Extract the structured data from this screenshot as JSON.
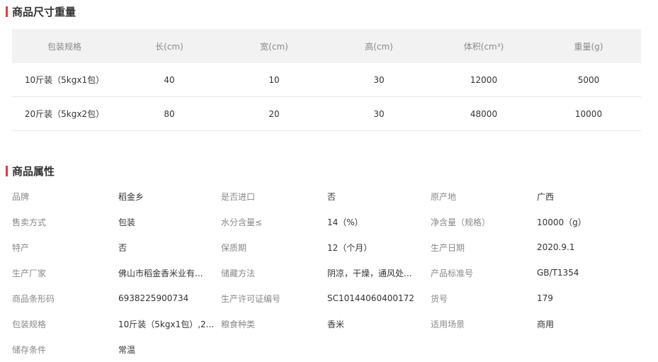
{
  "size_section": {
    "title": "商品尺寸重量",
    "headers": [
      "包装规格",
      "长(cm)",
      "宽(cm)",
      "高(cm)",
      "体积(cm³)",
      "重量(g)"
    ],
    "rows": [
      [
        "10斤装（5kgx1包）",
        "40",
        "10",
        "30",
        "12000",
        "5000"
      ],
      [
        "20斤装（5kgx2包）",
        "80",
        "20",
        "30",
        "48000",
        "10000"
      ]
    ]
  },
  "attr_section": {
    "title": "商品属性",
    "items": [
      {
        "key": "品牌",
        "value": "稻金乡"
      },
      {
        "key": "是否进口",
        "value": "否"
      },
      {
        "key": "原产地",
        "value": "广西"
      },
      {
        "key": "售卖方式",
        "value": "包装"
      },
      {
        "key": "水分含量≤",
        "value": "14（%）"
      },
      {
        "key": "净含量（规格）",
        "value": "10000（g）"
      },
      {
        "key": "特产",
        "value": "否"
      },
      {
        "key": "保质期",
        "value": "12（个月）"
      },
      {
        "key": "生产日期",
        "value": "2020.9.1"
      },
      {
        "key": "生产厂家",
        "value": "佛山市稻金香米业有..."
      },
      {
        "key": "储藏方法",
        "value": "阴凉，干燥，通风处..."
      },
      {
        "key": "产品标准号",
        "value": "GB/T1354"
      },
      {
        "key": "商品条形码",
        "value": "6938225900734"
      },
      {
        "key": "生产许可证编号",
        "value": "SC10144060400172"
      },
      {
        "key": "货号",
        "value": "179"
      },
      {
        "key": "包装规格",
        "value": "10斤装（5kgx1包）,2..."
      },
      {
        "key": "粮食种类",
        "value": "香米"
      },
      {
        "key": "适用场景",
        "value": "商用"
      },
      {
        "key": "储存条件",
        "value": "常温"
      }
    ]
  },
  "colors": {
    "accent": "#e4393c",
    "header_bg": "#f2f2f2"
  }
}
